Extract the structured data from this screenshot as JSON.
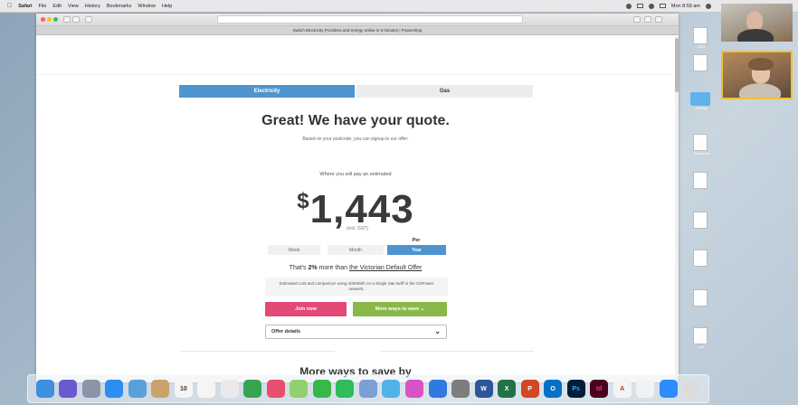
{
  "menubar": {
    "app": "Safari",
    "menus": [
      "File",
      "Edit",
      "View",
      "History",
      "Bookmarks",
      "Window",
      "Help"
    ],
    "clock": "Mon 8:59 am"
  },
  "browser": {
    "tab_title": "Switch Electricity Providers and energy online in 5 minutes | Powershop"
  },
  "page": {
    "tabs": {
      "electricity": "Electricity",
      "gas": "Gas"
    },
    "title": "Great! We have your quote.",
    "subtitle": "Based on your postcode, you can signup to our offer:",
    "estimate_label": "Where you will pay an estimated",
    "currency": "$",
    "price": "1,443",
    "gst": "(incl. GST)",
    "per_label": "Per",
    "periods": {
      "week": "Week",
      "month": "Month",
      "year": "Year"
    },
    "compare_prefix": "That's ",
    "compare_pct": "2%",
    "compare_mid": " more than ",
    "compare_link": "the Victorian Default Offer",
    "note": "Estimated cost and comparison using 4000kWh on a Single rate tariff in the CitiPower network.",
    "join_label": "Join now",
    "more_ways_label": "More ways to save ⌄",
    "offer_details": "Offer details",
    "save_title": "More ways to save by"
  },
  "desktop_files": [
    "...2019",
    "...",
    "...Pricing",
    "...Resources",
    "...",
    "...",
    "...",
    "...",
    "...pdf",
    "...docx",
    "...pdf"
  ],
  "dock_icons": [
    "finder-icon",
    "siri-icon",
    "launchpad-icon",
    "safari-icon",
    "preview-icon",
    "notes-icon",
    "calendar-icon",
    "reminders-icon",
    "numbers-icon",
    "photos-icon",
    "messages-icon",
    "facetime-icon",
    "itunes-icon",
    "app-store-icon",
    "system-prefs-icon",
    "word-icon",
    "excel-icon",
    "powerpoint-icon",
    "outlook-icon",
    "photoshop-icon",
    "indesign-icon",
    "acrobat-icon",
    "chrome-icon",
    "zoom-icon",
    "trash-icon"
  ],
  "colors": {
    "accent_blue": "#4e95cf",
    "join_pink": "#e34a76",
    "more_green": "#8ab84a"
  }
}
